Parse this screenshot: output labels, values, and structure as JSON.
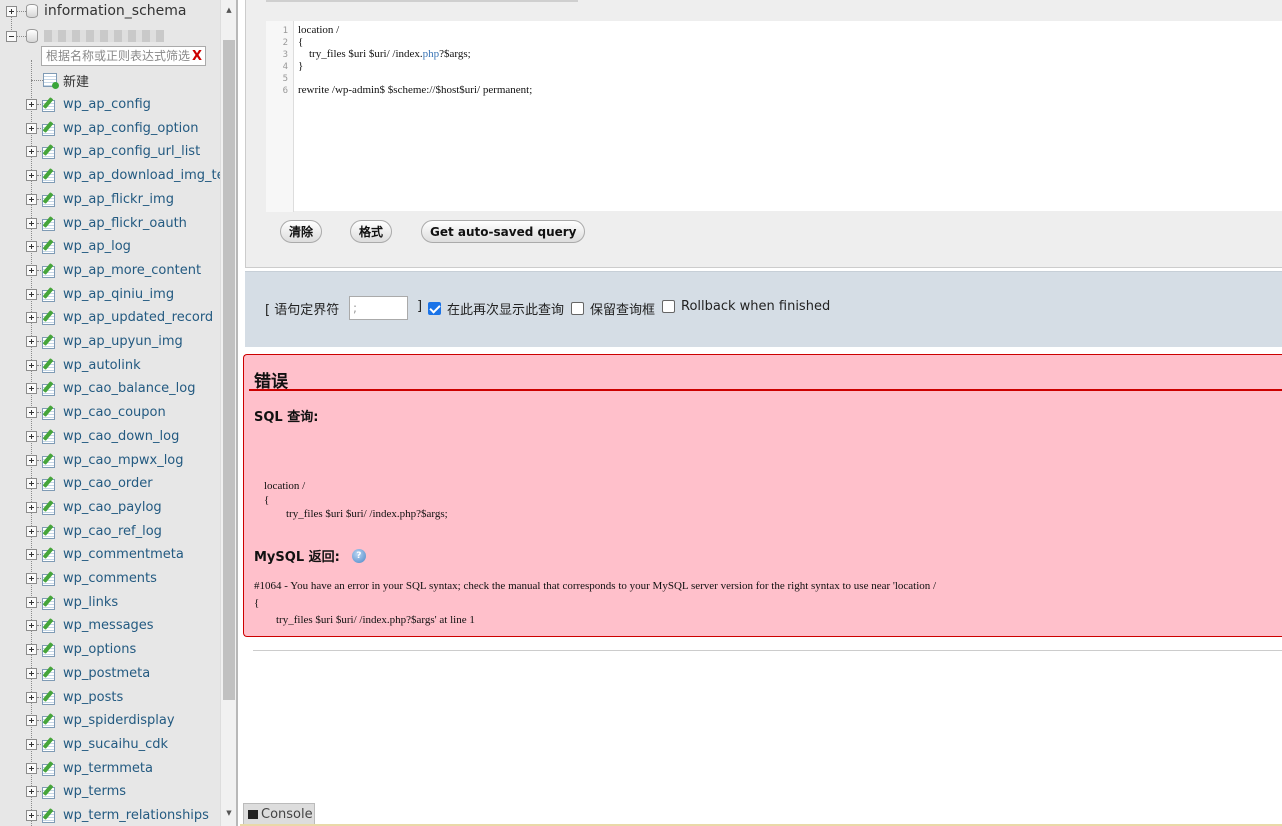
{
  "nav": {
    "information_schema": "information_schema",
    "filter_placeholder": "根据名称或正则表达式筛选",
    "filter_clear": "X",
    "new_label": "新建",
    "tables": [
      "wp_ap_config",
      "wp_ap_config_option",
      "wp_ap_config_url_list",
      "wp_ap_download_img_te",
      "wp_ap_flickr_img",
      "wp_ap_flickr_oauth",
      "wp_ap_log",
      "wp_ap_more_content",
      "wp_ap_qiniu_img",
      "wp_ap_updated_record",
      "wp_ap_upyun_img",
      "wp_autolink",
      "wp_cao_balance_log",
      "wp_cao_coupon",
      "wp_cao_down_log",
      "wp_cao_mpwx_log",
      "wp_cao_order",
      "wp_cao_paylog",
      "wp_cao_ref_log",
      "wp_commentmeta",
      "wp_comments",
      "wp_links",
      "wp_messages",
      "wp_options",
      "wp_postmeta",
      "wp_posts",
      "wp_spiderdisplay",
      "wp_sucaihu_cdk",
      "wp_termmeta",
      "wp_terms",
      "wp_term_relationships"
    ]
  },
  "editor": {
    "line_numbers": [
      "1",
      "2",
      "3",
      "4",
      "5",
      "6"
    ],
    "line1": "location /",
    "line2": "{",
    "line3_a": "    try_files $uri $uri/ /index.",
    "line3_kw": "php",
    "line3_b": "?$args;",
    "line4": "}",
    "line5": "",
    "line6": "rewrite /wp-admin$ $scheme://$host$uri/ permanent;"
  },
  "buttons": {
    "clear": "清除",
    "format": "格式",
    "autosaved": "Get auto-saved query"
  },
  "options": {
    "delimiter_open": "[ 语句定界符",
    "delimiter_value": ";",
    "delimiter_close": "]",
    "show_again": "在此再次显示此查询",
    "show_again_checked": true,
    "keep_box": "保留查询框",
    "rollback": "Rollback when finished"
  },
  "error": {
    "title": "错误",
    "sql_label": "SQL 查询:",
    "sql_line1": "location /",
    "sql_line2": "{",
    "sql_line3": "        try_files $uri $uri/ /index.php?$args;",
    "mysql_label": "MySQL 返回:",
    "help_icon": "?",
    "msg_line1": "#1064 - You have an error in your SQL syntax; check the manual that corresponds to your MySQL server version for the right syntax to use near 'location /",
    "msg_line2": "{",
    "msg_line3": "        try_files $uri $uri/ /index.php?$args' at line 1"
  },
  "console": {
    "label": "Console"
  },
  "colors": {
    "error_bg": "#ffc0cb",
    "error_border": "#cc0000",
    "link": "#235a81",
    "options_bg": "#d5dde5"
  }
}
